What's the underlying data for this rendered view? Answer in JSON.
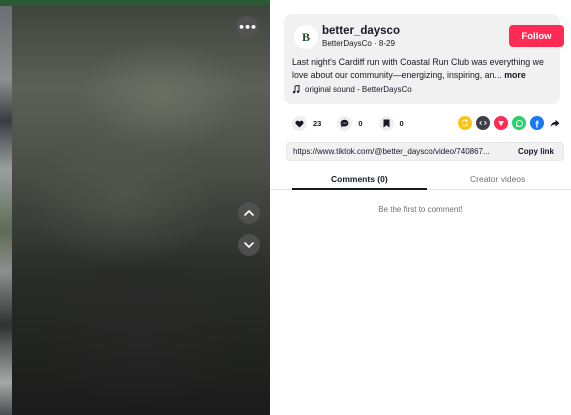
{
  "author": {
    "username": "better_daysco",
    "display_name": "BetterDaysCo",
    "date": "8-29",
    "separator": " · ",
    "avatar_letter": "B",
    "follow_label": "Follow"
  },
  "post": {
    "caption": "Last night's Cardiff run with Coastal Run Club was everything we love about our community—energizing, inspiring, an...",
    "more_label": "more",
    "sound_label": "original sound - BetterDaysCo"
  },
  "stats": {
    "likes": "23",
    "comments": "0",
    "saves": "0"
  },
  "share": {
    "icons": [
      "repost-icon",
      "embed-icon",
      "send-icon",
      "whatsapp-icon",
      "facebook-icon",
      "share-arrow-icon"
    ],
    "colors": {
      "repost": "#fcc419",
      "embed": "#3f3f46",
      "send": "#fe2c55",
      "whatsapp": "#25d366",
      "facebook": "#1877f2"
    }
  },
  "link": {
    "url": "https://www.tiktok.com/@better_daysco/video/740867...",
    "copy_label": "Copy link"
  },
  "tabs": {
    "comments_label": "Comments (0)",
    "creator_label": "Creator videos"
  },
  "comments": {
    "empty_message": "Be the first to comment!"
  },
  "colors": {
    "accent": "#fe2c55",
    "top_strip": "#2c5a35"
  }
}
